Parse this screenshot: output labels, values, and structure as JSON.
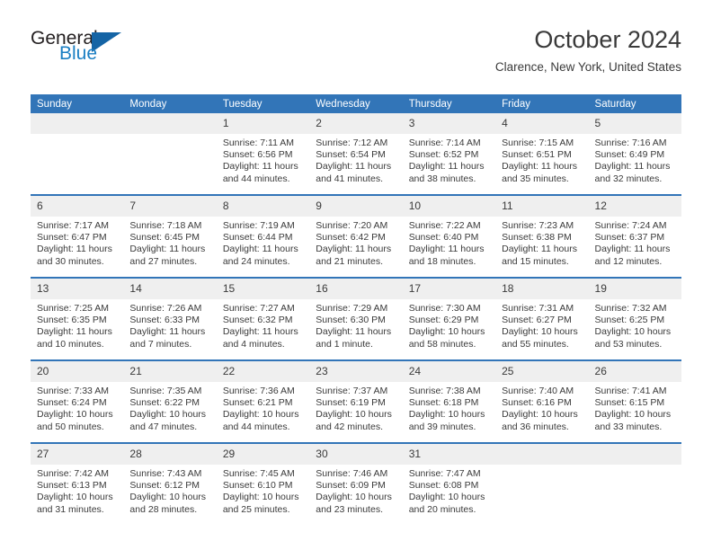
{
  "brand": {
    "logo_line1": "General",
    "logo_line2": "Blue",
    "logo_icon": "triangle-icon",
    "color_dark": "#231f20",
    "color_blue": "#1b7fc3",
    "color_triangle": "#1464a5"
  },
  "header": {
    "title": "October 2024",
    "subtitle": "Clarence, New York, United States"
  },
  "theme": {
    "header_blue": "#3275b8",
    "daynum_band": "#efefef",
    "text": "#3a3a3a"
  },
  "calendar": {
    "weekday_headers": [
      "Sunday",
      "Monday",
      "Tuesday",
      "Wednesday",
      "Thursday",
      "Friday",
      "Saturday"
    ],
    "labels": {
      "sunrise": "Sunrise:",
      "sunset": "Sunset:",
      "daylight": "Daylight:"
    },
    "weeks": [
      [
        {
          "day": "",
          "blank": true,
          "sunrise": "",
          "sunset": "",
          "daylight_line1": "",
          "daylight_line2": ""
        },
        {
          "day": "",
          "blank": true,
          "sunrise": "",
          "sunset": "",
          "daylight_line1": "",
          "daylight_line2": ""
        },
        {
          "day": "1",
          "sunrise": "Sunrise: 7:11 AM",
          "sunset": "Sunset: 6:56 PM",
          "daylight_line1": "Daylight: 11 hours",
          "daylight_line2": "and 44 minutes."
        },
        {
          "day": "2",
          "sunrise": "Sunrise: 7:12 AM",
          "sunset": "Sunset: 6:54 PM",
          "daylight_line1": "Daylight: 11 hours",
          "daylight_line2": "and 41 minutes."
        },
        {
          "day": "3",
          "sunrise": "Sunrise: 7:14 AM",
          "sunset": "Sunset: 6:52 PM",
          "daylight_line1": "Daylight: 11 hours",
          "daylight_line2": "and 38 minutes."
        },
        {
          "day": "4",
          "sunrise": "Sunrise: 7:15 AM",
          "sunset": "Sunset: 6:51 PM",
          "daylight_line1": "Daylight: 11 hours",
          "daylight_line2": "and 35 minutes."
        },
        {
          "day": "5",
          "sunrise": "Sunrise: 7:16 AM",
          "sunset": "Sunset: 6:49 PM",
          "daylight_line1": "Daylight: 11 hours",
          "daylight_line2": "and 32 minutes."
        }
      ],
      [
        {
          "day": "6",
          "sunrise": "Sunrise: 7:17 AM",
          "sunset": "Sunset: 6:47 PM",
          "daylight_line1": "Daylight: 11 hours",
          "daylight_line2": "and 30 minutes."
        },
        {
          "day": "7",
          "sunrise": "Sunrise: 7:18 AM",
          "sunset": "Sunset: 6:45 PM",
          "daylight_line1": "Daylight: 11 hours",
          "daylight_line2": "and 27 minutes."
        },
        {
          "day": "8",
          "sunrise": "Sunrise: 7:19 AM",
          "sunset": "Sunset: 6:44 PM",
          "daylight_line1": "Daylight: 11 hours",
          "daylight_line2": "and 24 minutes."
        },
        {
          "day": "9",
          "sunrise": "Sunrise: 7:20 AM",
          "sunset": "Sunset: 6:42 PM",
          "daylight_line1": "Daylight: 11 hours",
          "daylight_line2": "and 21 minutes."
        },
        {
          "day": "10",
          "sunrise": "Sunrise: 7:22 AM",
          "sunset": "Sunset: 6:40 PM",
          "daylight_line1": "Daylight: 11 hours",
          "daylight_line2": "and 18 minutes."
        },
        {
          "day": "11",
          "sunrise": "Sunrise: 7:23 AM",
          "sunset": "Sunset: 6:38 PM",
          "daylight_line1": "Daylight: 11 hours",
          "daylight_line2": "and 15 minutes."
        },
        {
          "day": "12",
          "sunrise": "Sunrise: 7:24 AM",
          "sunset": "Sunset: 6:37 PM",
          "daylight_line1": "Daylight: 11 hours",
          "daylight_line2": "and 12 minutes."
        }
      ],
      [
        {
          "day": "13",
          "sunrise": "Sunrise: 7:25 AM",
          "sunset": "Sunset: 6:35 PM",
          "daylight_line1": "Daylight: 11 hours",
          "daylight_line2": "and 10 minutes."
        },
        {
          "day": "14",
          "sunrise": "Sunrise: 7:26 AM",
          "sunset": "Sunset: 6:33 PM",
          "daylight_line1": "Daylight: 11 hours",
          "daylight_line2": "and 7 minutes."
        },
        {
          "day": "15",
          "sunrise": "Sunrise: 7:27 AM",
          "sunset": "Sunset: 6:32 PM",
          "daylight_line1": "Daylight: 11 hours",
          "daylight_line2": "and 4 minutes."
        },
        {
          "day": "16",
          "sunrise": "Sunrise: 7:29 AM",
          "sunset": "Sunset: 6:30 PM",
          "daylight_line1": "Daylight: 11 hours",
          "daylight_line2": "and 1 minute."
        },
        {
          "day": "17",
          "sunrise": "Sunrise: 7:30 AM",
          "sunset": "Sunset: 6:29 PM",
          "daylight_line1": "Daylight: 10 hours",
          "daylight_line2": "and 58 minutes."
        },
        {
          "day": "18",
          "sunrise": "Sunrise: 7:31 AM",
          "sunset": "Sunset: 6:27 PM",
          "daylight_line1": "Daylight: 10 hours",
          "daylight_line2": "and 55 minutes."
        },
        {
          "day": "19",
          "sunrise": "Sunrise: 7:32 AM",
          "sunset": "Sunset: 6:25 PM",
          "daylight_line1": "Daylight: 10 hours",
          "daylight_line2": "and 53 minutes."
        }
      ],
      [
        {
          "day": "20",
          "sunrise": "Sunrise: 7:33 AM",
          "sunset": "Sunset: 6:24 PM",
          "daylight_line1": "Daylight: 10 hours",
          "daylight_line2": "and 50 minutes."
        },
        {
          "day": "21",
          "sunrise": "Sunrise: 7:35 AM",
          "sunset": "Sunset: 6:22 PM",
          "daylight_line1": "Daylight: 10 hours",
          "daylight_line2": "and 47 minutes."
        },
        {
          "day": "22",
          "sunrise": "Sunrise: 7:36 AM",
          "sunset": "Sunset: 6:21 PM",
          "daylight_line1": "Daylight: 10 hours",
          "daylight_line2": "and 44 minutes."
        },
        {
          "day": "23",
          "sunrise": "Sunrise: 7:37 AM",
          "sunset": "Sunset: 6:19 PM",
          "daylight_line1": "Daylight: 10 hours",
          "daylight_line2": "and 42 minutes."
        },
        {
          "day": "24",
          "sunrise": "Sunrise: 7:38 AM",
          "sunset": "Sunset: 6:18 PM",
          "daylight_line1": "Daylight: 10 hours",
          "daylight_line2": "and 39 minutes."
        },
        {
          "day": "25",
          "sunrise": "Sunrise: 7:40 AM",
          "sunset": "Sunset: 6:16 PM",
          "daylight_line1": "Daylight: 10 hours",
          "daylight_line2": "and 36 minutes."
        },
        {
          "day": "26",
          "sunrise": "Sunrise: 7:41 AM",
          "sunset": "Sunset: 6:15 PM",
          "daylight_line1": "Daylight: 10 hours",
          "daylight_line2": "and 33 minutes."
        }
      ],
      [
        {
          "day": "27",
          "sunrise": "Sunrise: 7:42 AM",
          "sunset": "Sunset: 6:13 PM",
          "daylight_line1": "Daylight: 10 hours",
          "daylight_line2": "and 31 minutes."
        },
        {
          "day": "28",
          "sunrise": "Sunrise: 7:43 AM",
          "sunset": "Sunset: 6:12 PM",
          "daylight_line1": "Daylight: 10 hours",
          "daylight_line2": "and 28 minutes."
        },
        {
          "day": "29",
          "sunrise": "Sunrise: 7:45 AM",
          "sunset": "Sunset: 6:10 PM",
          "daylight_line1": "Daylight: 10 hours",
          "daylight_line2": "and 25 minutes."
        },
        {
          "day": "30",
          "sunrise": "Sunrise: 7:46 AM",
          "sunset": "Sunset: 6:09 PM",
          "daylight_line1": "Daylight: 10 hours",
          "daylight_line2": "and 23 minutes."
        },
        {
          "day": "31",
          "sunrise": "Sunrise: 7:47 AM",
          "sunset": "Sunset: 6:08 PM",
          "daylight_line1": "Daylight: 10 hours",
          "daylight_line2": "and 20 minutes."
        },
        {
          "day": "",
          "blank": true,
          "sunrise": "",
          "sunset": "",
          "daylight_line1": "",
          "daylight_line2": ""
        },
        {
          "day": "",
          "blank": true,
          "sunrise": "",
          "sunset": "",
          "daylight_line1": "",
          "daylight_line2": ""
        }
      ]
    ]
  }
}
